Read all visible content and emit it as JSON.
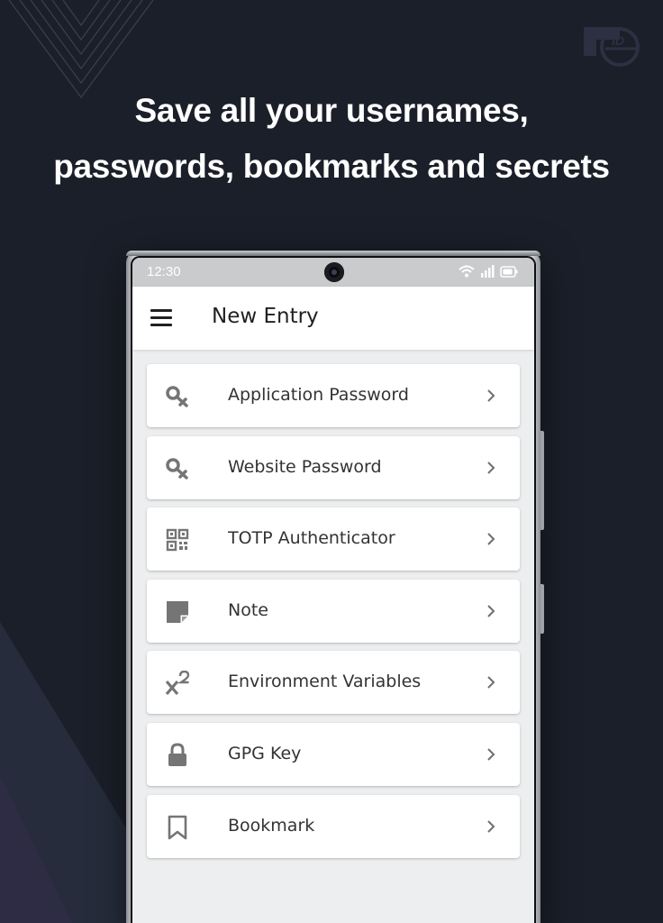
{
  "headline": {
    "line1": "Save all your usernames,",
    "line2": "passwords, bookmarks and secrets"
  },
  "colors": {
    "background": "#1b1f29",
    "headline": "#ffffff",
    "statusbar": "#c9cbcd",
    "appbar": "#ffffff",
    "list_background": "#eceeef",
    "icon_gray": "#757575"
  },
  "statusbar": {
    "time": "12:30"
  },
  "appbar": {
    "menu_icon": "hamburger-menu-icon",
    "title": "New Entry"
  },
  "entries": [
    {
      "label": "Application Password",
      "icon": "key-icon"
    },
    {
      "label": "Website Password",
      "icon": "key-icon"
    },
    {
      "label": "TOTP Authenticator",
      "icon": "qr-code-icon"
    },
    {
      "label": "Note",
      "icon": "note-icon"
    },
    {
      "label": "Environment Variables",
      "icon": "superscript-icon"
    },
    {
      "label": "GPG Key",
      "icon": "lock-icon"
    },
    {
      "label": "Bookmark",
      "icon": "bookmark-icon"
    }
  ]
}
